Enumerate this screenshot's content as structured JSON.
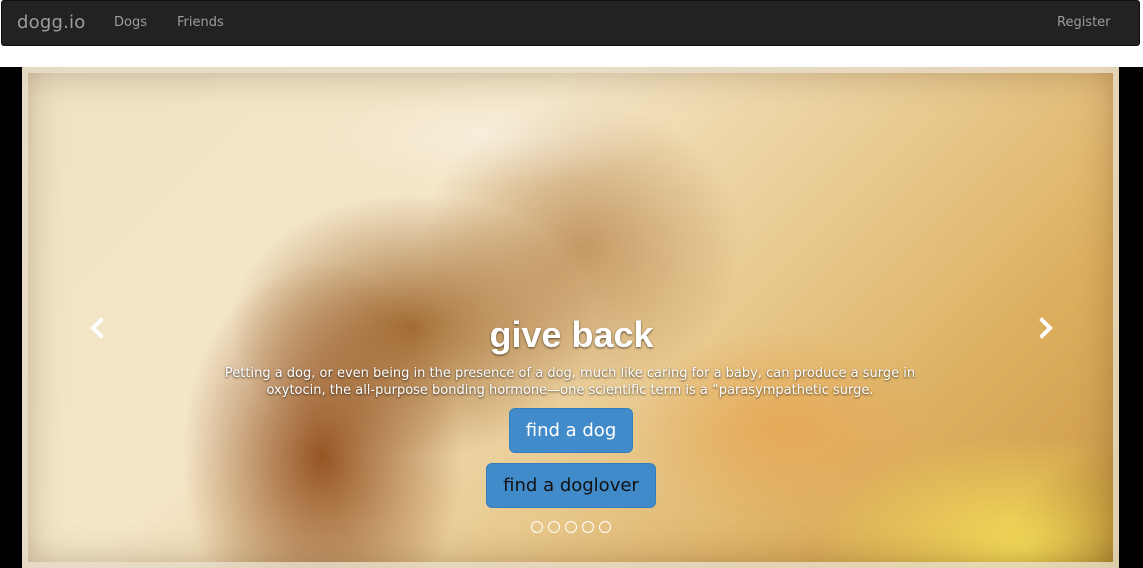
{
  "navbar": {
    "brand": "dogg.io",
    "links": [
      "Dogs",
      "Friends"
    ],
    "register": "Register"
  },
  "carousel": {
    "headline": "give back",
    "blurb": "Petting a dog, or even being in the presence of a dog, much like caring for a baby, can produce a surge in oxytocin, the all-purpose bonding hormone—one scientific term is a “parasympathetic surge.",
    "buttons": {
      "find_dog": "find a dog",
      "find_doglover": "find a doglover"
    },
    "prev_icon": "chevron-left-icon",
    "next_icon": "chevron-right-icon",
    "slide_count": 5,
    "active_slide": 0
  },
  "colors": {
    "navbar_bg": "#222222",
    "navbar_text": "#9d9d9d",
    "button_primary": "#428bca"
  }
}
